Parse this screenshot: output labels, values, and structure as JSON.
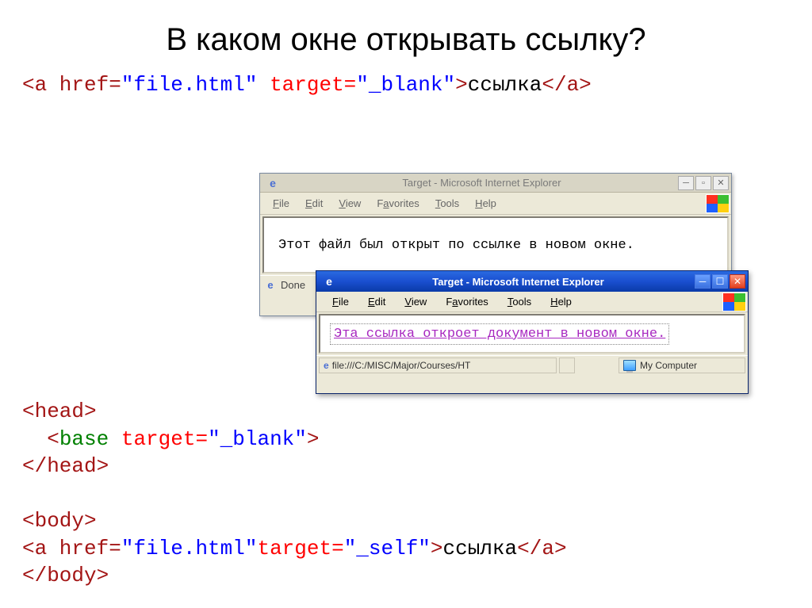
{
  "title": "В каком окне открывать ссылку?",
  "code1": {
    "p1": "<a href=",
    "p2": "\"file.html\"",
    "p3": " target=",
    "p4": "\"_blank\"",
    "p5": ">",
    "p6": "ссылка",
    "p7": "</a>"
  },
  "winBack": {
    "title": "Target - Microsoft Internet Explorer",
    "menu": {
      "file": "File",
      "edit": "Edit",
      "view": "View",
      "fav": "Favorites",
      "tools": "Tools",
      "help": "Help"
    },
    "content": "Этот файл был открыт по ссылке в новом окне.",
    "status": "Done"
  },
  "winFront": {
    "title": "Target - Microsoft Internet Explorer",
    "menu": {
      "file": "File",
      "edit": "Edit",
      "view": "View",
      "fav": "Favorites",
      "tools": "Tools",
      "help": "Help"
    },
    "link": "Эта ссылка откроет документ в новом окне.",
    "addr": "file:///C:/MISC/Major/Courses/HT",
    "zone": "My Computer"
  },
  "code2": {
    "l1a": "<head>",
    "l2a": "  <",
    "l2b": "base",
    "l2c": " target=",
    "l2d": "\"_blank\"",
    "l2e": ">",
    "l3a": "</head>",
    "l5a": "<body>",
    "l6a": "<a href=",
    "l6b": "\"file.html\"",
    "l6c": "target=",
    "l6d": "\"_self\"",
    "l6e": ">",
    "l6f": "ссылка",
    "l6g": "</a>",
    "l7a": "</body>"
  }
}
